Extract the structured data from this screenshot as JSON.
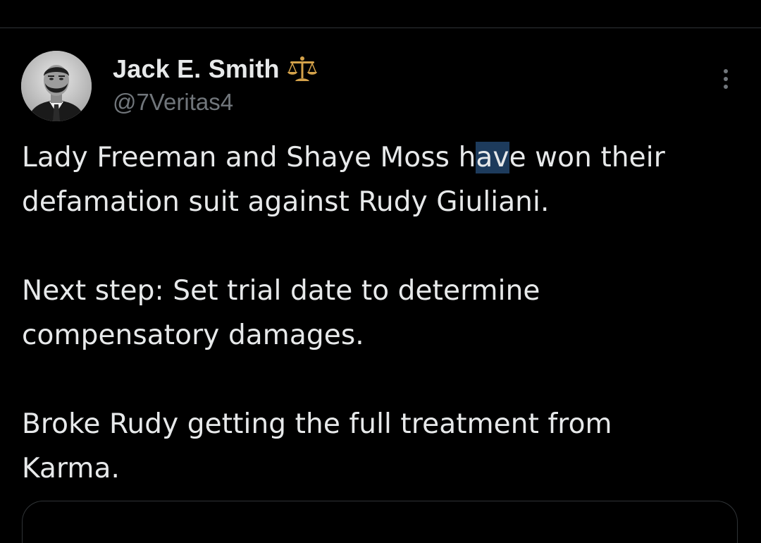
{
  "tweet": {
    "author": {
      "display_name": "Jack E. Smith",
      "handle": "@7Veritas4",
      "badge_icon": "balance-scale-icon"
    },
    "more_icon": "more-vertical-icon",
    "body": {
      "paragraph_1": {
        "before": "Lady Freeman and Shaye Moss h",
        "highlighted": "av",
        "after": "e won their",
        "line_2": "defamation suit against Rudy Giuliani."
      },
      "paragraph_2": {
        "line_1": "Next step: Set trial date to determine",
        "line_2": "compensatory damages."
      },
      "paragraph_3": {
        "line_1": "Broke Rudy getting the full treatment from",
        "line_2": "Karma."
      }
    }
  },
  "colors": {
    "background": "#000000",
    "text_primary": "#e7e9ea",
    "text_secondary": "#71767b",
    "divider": "#2f3336",
    "selection": "#1d3b5c",
    "badge_gold": "#d4a24a"
  }
}
